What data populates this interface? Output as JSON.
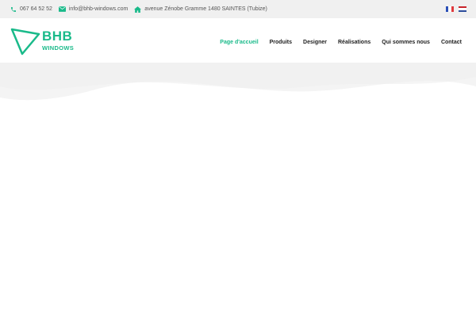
{
  "topbar": {
    "phone": "067 64 52 52",
    "email": "info@bhb-windows.com",
    "address": "avenue Zénobe Gramme 1480 SAINTES (Tubize)",
    "icons": [
      "phone-icon",
      "envelope-icon",
      "home-icon"
    ],
    "languages": [
      "fr-flag",
      "nl-flag"
    ]
  },
  "header": {
    "logo": {
      "brand": "BHB",
      "sub": "WINDOWS"
    },
    "nav": [
      {
        "label": "Page d'accueil",
        "active": true
      },
      {
        "label": "Produits",
        "active": false
      },
      {
        "label": "Designer",
        "active": false
      },
      {
        "label": "Réalisations",
        "active": false
      },
      {
        "label": "Qui sommes nous",
        "active": false
      },
      {
        "label": "Contact",
        "active": false
      }
    ]
  },
  "colors": {
    "accent": "#1aba8a",
    "topbar_bg": "#f0f0f0",
    "text": "#222222",
    "muted_text": "#555555"
  }
}
